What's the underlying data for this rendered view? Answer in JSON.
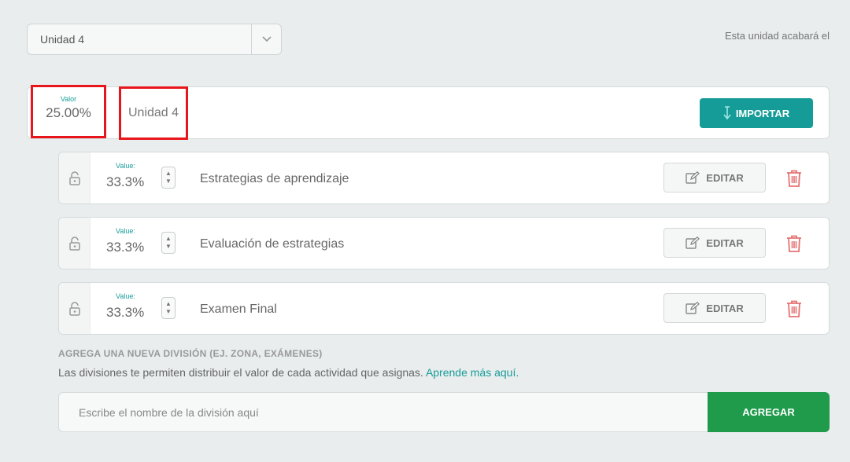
{
  "unit_select": {
    "value": "Unidad 4",
    "icon": "chevron-down-icon"
  },
  "end_label": "Esta unidad acabará el",
  "unit_card": {
    "value_label": "Valor",
    "value": "25.00%",
    "name": "Unidad 4",
    "import_label": "IMPORTAR"
  },
  "divisions": [
    {
      "value_label": "Value:",
      "value": "33.3%",
      "name": "Estrategias de aprendizaje",
      "edit_label": "EDITAR"
    },
    {
      "value_label": "Value:",
      "value": "33.3%",
      "name": "Evaluación de estrategias",
      "edit_label": "EDITAR"
    },
    {
      "value_label": "Value:",
      "value": "33.3%",
      "name": "Examen Final",
      "edit_label": "EDITAR"
    }
  ],
  "add_division": {
    "title": "AGREGA UNA NUEVA DIVISIÓN (EJ. ZONA, EXÁMENES)",
    "description": "Las divisiones te permiten distribuir el valor de cada actividad que asignas.",
    "learn_more": "Aprende más aquí.",
    "input_value": "",
    "placeholder": "Escribe el nombre de la división aquí",
    "button_label": "AGREGAR"
  },
  "colors": {
    "accent_teal": "#169c98",
    "add_green": "#1f9b4b",
    "trash_red": "#e57373",
    "highlight_red": "#e8161b"
  }
}
